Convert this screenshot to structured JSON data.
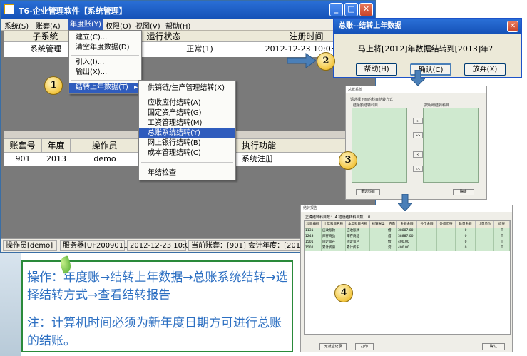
{
  "main_window": {
    "title": "T6-企业管理软件【系统管理】",
    "menus": [
      "系统(S)",
      "账套(A)",
      "年度账(Y)",
      "权限(O)",
      "视图(V)",
      "帮助(H)"
    ],
    "top_table": {
      "headers": [
        "子系统",
        "运行状态",
        "注册时间"
      ],
      "row": [
        "系统管理",
        "正常(1)",
        "2012-12-23 10:03:25"
      ]
    },
    "dropdown": [
      "建立(C)...",
      "清空年度数据(D)",
      "引入(I)...",
      "输出(X)...",
      "结转上年数据(T)"
    ],
    "submenu": [
      "供销链/生产管理结转(X)",
      "应收应付结转(A)",
      "固定资产结转(G)",
      "工资管理结转(M)",
      "总账系统结转(Y)",
      "网上银行结转(B)",
      "成本管理结转(C)",
      "年结检查"
    ],
    "bottom_table": {
      "headers": [
        "账套号",
        "年度",
        "操作员",
        "执行功能"
      ],
      "row": [
        "901",
        "2013",
        "demo",
        "系统注册"
      ]
    },
    "status": [
      "操作员[demo]",
      "服务器[UF2009011]",
      "2012-12-23 10:08",
      "当前账套：[901] 会计年度：[2013]"
    ]
  },
  "dialog_confirm": {
    "title": "总账--结转上年数据",
    "message": "马上将[2012]年数据结转到[2013]年?",
    "buttons": [
      "帮助(H)",
      "确认(C)",
      "放弃(X)"
    ]
  },
  "dialog_method": {
    "title": "总帐系统",
    "group_label": "请选择下面的科目结转方式",
    "left_label": "结余额结转科目",
    "right_label": "按明细结转科目",
    "mid_buttons": [
      ">",
      ">>",
      "<",
      "<<"
    ],
    "buttons": [
      "重选科目",
      "确定"
    ]
  },
  "report": {
    "title": "结转报告",
    "summary": "正确结转科目数： 4    错误结转科目数： 0",
    "headers": [
      "科目编码",
      "上年科目名称",
      "本年科目名称",
      "核算账类",
      "方向",
      "金额余额",
      "外币余额",
      "外币币符",
      "数量余额",
      "计量单位",
      "结果"
    ],
    "rows": [
      [
        "1131",
        "应收账款",
        "应收账款",
        "",
        "借",
        "38887.00",
        "",
        "",
        "0",
        "",
        "T"
      ],
      [
        "1243",
        "库存商品",
        "库存商品",
        "",
        "借",
        "38887.00",
        "",
        "",
        "0",
        "",
        "T"
      ],
      [
        "1501",
        "固定资产",
        "固定资产",
        "",
        "借",
        "400.00",
        "",
        "",
        "0",
        "",
        "T"
      ],
      [
        "1502",
        "累计折旧",
        "累计折旧",
        "",
        "贷",
        "400.00",
        "",
        "",
        "0",
        "",
        "T"
      ]
    ],
    "buttons": [
      "无对应记录",
      "打印",
      "确认"
    ]
  },
  "markers": [
    "1",
    "2",
    "3",
    "4"
  ],
  "info": {
    "operation": "操作：年度账→结转上年数据→总账系统结转→选择结转方式→查看结转报告",
    "note": "注：计算机时间必须为新年度日期方可进行总账的结账。"
  },
  "colors": {
    "title_blue": "#1552b8",
    "menu_highlight": "#2f5cbd",
    "info_text": "#2c6fc2",
    "info_border": "#2a8a3a",
    "arrow": "#4a7fb8"
  }
}
